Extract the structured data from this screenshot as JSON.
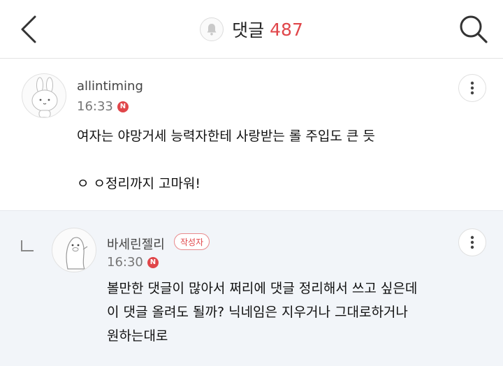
{
  "header": {
    "title": "댓글",
    "count": "487",
    "icons": {
      "back": "back-chevron-icon",
      "bell": "bell-icon",
      "search": "search-icon"
    }
  },
  "comments": [
    {
      "username": "allintiming",
      "time": "16:33",
      "new_badge": "N",
      "text": "여자는 야망거세 능력자한테 사랑받는 롤 주입도 큰 듯\n\nㅇ ㅇ정리까지 고마워!"
    },
    {
      "username": "바세린젤리",
      "author_badge": "작성자",
      "time": "16:30",
      "new_badge": "N",
      "text": "볼만한 댓글이 많아서 쩌리에 댓글 정리해서 쓰고 싶은데\n이 댓글 올려도 될까? 닉네임은 지우거나 그대로하거나\n원하는대로"
    }
  ],
  "colors": {
    "accent": "#e0464a",
    "reply_bg": "#f2f5f9"
  }
}
